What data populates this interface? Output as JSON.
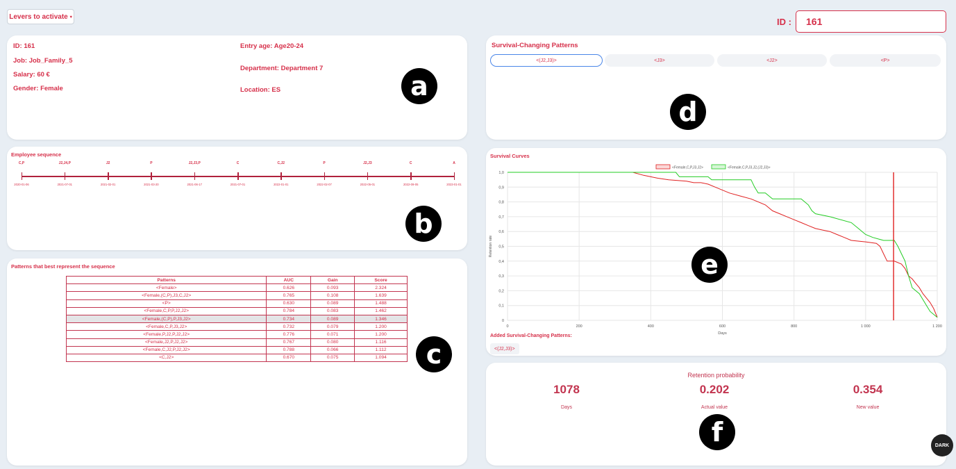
{
  "header": {
    "levers_label": "Levers to activate",
    "id_label": "ID :",
    "id_value": "161"
  },
  "markers": {
    "a": "a",
    "b": "b",
    "c": "c",
    "d": "d",
    "e": "e",
    "f": "f"
  },
  "employee": {
    "id_label": "ID:",
    "id": "161",
    "job_label": "Job:",
    "job": "Job_Family_5",
    "salary_label": "Salary:",
    "salary": "60 €",
    "gender_label": "Gender:",
    "gender": "Female",
    "entry_age_label": "Entry age:",
    "entry_age": "Age20-24",
    "department_label": "Department:",
    "department": "Department 7",
    "location_label": "Location:",
    "location": "ES"
  },
  "sequence": {
    "title": "Employee sequence",
    "events": [
      {
        "label": "C,P",
        "date": "2020-01-06"
      },
      {
        "label": "J2,J4,P",
        "date": "2021-07-01"
      },
      {
        "label": "J2",
        "date": "2021-02-01"
      },
      {
        "label": "P",
        "date": "2021-03-20"
      },
      {
        "label": "J2,J3,P",
        "date": "2021-06-17"
      },
      {
        "label": "C",
        "date": "2021-07-01"
      },
      {
        "label": "C,J2",
        "date": "2022-01-01"
      },
      {
        "label": "P",
        "date": "2022-02-07"
      },
      {
        "label": "J2,J3",
        "date": "2022-05-01"
      },
      {
        "label": "C",
        "date": "2022-09-05"
      },
      {
        "label": "A",
        "date": "2023-01-01"
      }
    ]
  },
  "patterns": {
    "title": "Patterns that best represent the sequence",
    "headers": [
      "Patterns",
      "AUC",
      "Gain",
      "Score"
    ],
    "rows": [
      [
        "<Female>",
        "0.626",
        "0.093",
        "2.324"
      ],
      [
        "<Female,(C,P),J3,C,J2>",
        "0.765",
        "0.108",
        "1.639"
      ],
      [
        "<P>",
        "0.630",
        "0.089",
        "1.488"
      ],
      [
        "<Female,C,P,P,J2,J2>",
        "0.784",
        "0.083",
        "1.462"
      ],
      [
        "<Female,(C,P),P,J3,J2>",
        "0.734",
        "0.089",
        "1.346"
      ],
      [
        "<Female,C,P,J3,J2>",
        "0.732",
        "0.079",
        "1.200"
      ],
      [
        "<Female,P,J2,P,J2,J2>",
        "0.776",
        "0.071",
        "1.200"
      ],
      [
        "<Female,J2,P,J2,J2>",
        "0.767",
        "0.080",
        "1.116"
      ],
      [
        "<Female,C,J2,P,J2,J2>",
        "0.788",
        "0.066",
        "1.112"
      ],
      [
        "<C,J2>",
        "0.670",
        "0.075",
        "1.094"
      ]
    ],
    "highlighted_row": 4
  },
  "survival_patterns": {
    "title": "Survival-Changing Patterns",
    "tabs": [
      "<(J2,J3)>",
      "<J3>",
      "<J2>",
      "<P>"
    ],
    "active_tab": 0
  },
  "survival_curves": {
    "title": "Survival Curves",
    "added_label": "Added Survival-Changing Patterns:",
    "added_pill": "<(J2,J3)>"
  },
  "retention": {
    "title": "Retention probability",
    "days": "1078",
    "days_label": "Days",
    "actual": "0.202",
    "actual_label": "Actual value",
    "new": "0.354",
    "new_label": "New value"
  },
  "dark_button": "DARK",
  "colors": {
    "accent": "#d6304a",
    "series_red": "#e02020",
    "series_green": "#22cc22"
  },
  "chart_data": {
    "type": "line",
    "title": "",
    "xlabel": "Days",
    "ylabel": "Retention rate",
    "xlim": [
      0,
      1200
    ],
    "ylim": [
      0,
      1.0
    ],
    "x_ticks": [
      "0",
      "200",
      "400",
      "600",
      "800",
      "1 000",
      "1 200"
    ],
    "y_ticks": [
      "0",
      "0,1",
      "0,2",
      "0,3",
      "0,4",
      "0,5",
      "0,6",
      "0,7",
      "0,8",
      "0,9",
      "1,0"
    ],
    "grid": true,
    "legend": "top-center",
    "vline_x": 1078,
    "series": [
      {
        "name": "<Female,C,P,J3,J2>",
        "color": "#e02020",
        "points": [
          [
            0,
            1.0
          ],
          [
            350,
            1.0
          ],
          [
            380,
            0.98
          ],
          [
            400,
            0.97
          ],
          [
            420,
            0.96
          ],
          [
            450,
            0.95
          ],
          [
            500,
            0.94
          ],
          [
            520,
            0.93
          ],
          [
            540,
            0.93
          ],
          [
            560,
            0.92
          ],
          [
            580,
            0.9
          ],
          [
            600,
            0.88
          ],
          [
            620,
            0.86
          ],
          [
            650,
            0.84
          ],
          [
            680,
            0.82
          ],
          [
            700,
            0.8
          ],
          [
            720,
            0.78
          ],
          [
            740,
            0.74
          ],
          [
            760,
            0.72
          ],
          [
            780,
            0.7
          ],
          [
            800,
            0.68
          ],
          [
            820,
            0.66
          ],
          [
            840,
            0.64
          ],
          [
            860,
            0.62
          ],
          [
            880,
            0.61
          ],
          [
            900,
            0.6
          ],
          [
            920,
            0.58
          ],
          [
            940,
            0.56
          ],
          [
            960,
            0.54
          ],
          [
            1000,
            0.53
          ],
          [
            1030,
            0.52
          ],
          [
            1040,
            0.5
          ],
          [
            1050,
            0.45
          ],
          [
            1060,
            0.4
          ],
          [
            1080,
            0.4
          ],
          [
            1100,
            0.38
          ],
          [
            1110,
            0.35
          ],
          [
            1120,
            0.3
          ],
          [
            1130,
            0.28
          ],
          [
            1140,
            0.25
          ],
          [
            1150,
            0.22
          ],
          [
            1160,
            0.18
          ],
          [
            1170,
            0.15
          ],
          [
            1180,
            0.12
          ],
          [
            1190,
            0.08
          ],
          [
            1200,
            0.02
          ]
        ]
      },
      {
        "name": "<Female,C,P,J3,J2,(J2,J3)>",
        "color": "#22cc22",
        "points": [
          [
            0,
            1.0
          ],
          [
            470,
            1.0
          ],
          [
            480,
            0.97
          ],
          [
            560,
            0.97
          ],
          [
            570,
            0.95
          ],
          [
            680,
            0.95
          ],
          [
            690,
            0.9
          ],
          [
            700,
            0.86
          ],
          [
            720,
            0.86
          ],
          [
            740,
            0.82
          ],
          [
            820,
            0.82
          ],
          [
            840,
            0.78
          ],
          [
            850,
            0.74
          ],
          [
            860,
            0.72
          ],
          [
            900,
            0.7
          ],
          [
            960,
            0.66
          ],
          [
            980,
            0.62
          ],
          [
            990,
            0.6
          ],
          [
            1000,
            0.58
          ],
          [
            1020,
            0.56
          ],
          [
            1050,
            0.54
          ],
          [
            1080,
            0.54
          ],
          [
            1090,
            0.5
          ],
          [
            1100,
            0.45
          ],
          [
            1110,
            0.4
          ],
          [
            1120,
            0.3
          ],
          [
            1130,
            0.22
          ],
          [
            1140,
            0.2
          ],
          [
            1150,
            0.18
          ],
          [
            1160,
            0.14
          ],
          [
            1170,
            0.1
          ],
          [
            1180,
            0.06
          ],
          [
            1200,
            0.02
          ]
        ]
      }
    ]
  }
}
